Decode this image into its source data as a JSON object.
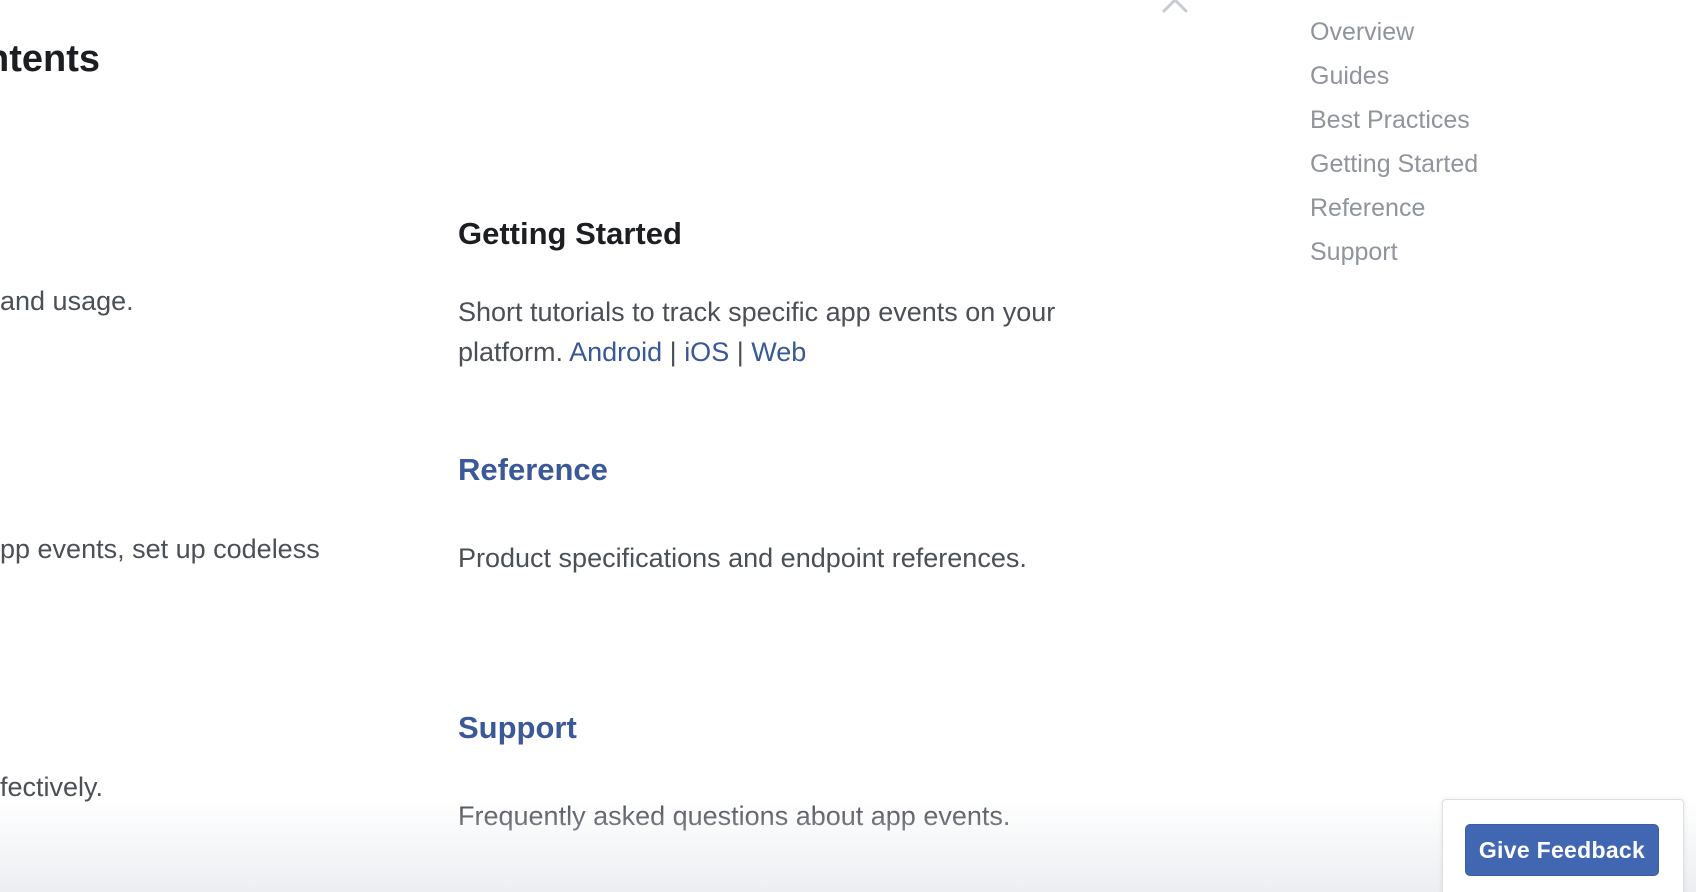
{
  "left_column": {
    "title_fragment": "ntents",
    "line_1": " and usage.",
    "line_2": "pp events, set up codeless",
    "line_3": "fectively."
  },
  "main": {
    "getting_started": {
      "heading": "Getting Started",
      "text_line_1": "Short tutorials to track specific app events on your",
      "text_prefix": "platform.",
      "links": [
        "Android",
        "iOS",
        "Web"
      ],
      "separator": "|"
    },
    "reference": {
      "heading": "Reference",
      "text": "Product specifications and endpoint references."
    },
    "support": {
      "heading": "Support",
      "text": "Frequently asked questions about app events."
    }
  },
  "toc": {
    "items": [
      "Overview",
      "Guides",
      "Best Practices",
      "Getting Started",
      "Reference",
      "Support"
    ],
    "scroll_top_icon": "chevron-up-icon"
  },
  "feedback": {
    "button_label": "Give Feedback"
  },
  "colors": {
    "link": "#3b5998",
    "button": "#4267b2",
    "toc_text": "#90949c",
    "body_text": "#4b4f56"
  }
}
